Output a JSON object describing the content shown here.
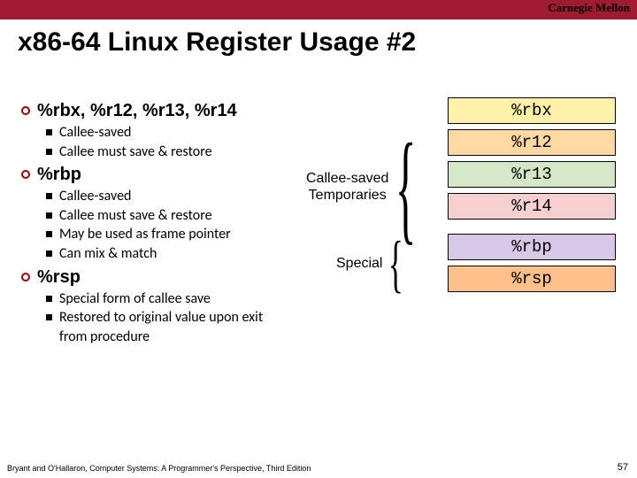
{
  "brand": "Carnegie Mellon",
  "title": "x86-64 Linux Register Usage #2",
  "sections": [
    {
      "heading": "%rbx, %r12, %r13, %r14",
      "items": [
        "Callee-saved",
        "Callee must save & restore"
      ]
    },
    {
      "heading": "%rbp",
      "items": [
        "Callee-saved",
        "Callee must save & restore",
        "May be used as frame pointer",
        "Can mix & match"
      ]
    },
    {
      "heading": "%rsp",
      "items": [
        "Special form of callee save",
        "Restored to original value upon exit from procedure"
      ]
    }
  ],
  "group_labels": {
    "callee_saved_line1": "Callee-saved",
    "callee_saved_line2": "Temporaries",
    "special": "Special"
  },
  "registers": [
    {
      "name": "%rbx",
      "color": "c-yellow"
    },
    {
      "name": "%r12",
      "color": "c-peach"
    },
    {
      "name": "%r13",
      "color": "c-green"
    },
    {
      "name": "%r14",
      "color": "c-pink"
    },
    {
      "name": "%rbp",
      "color": "c-purple"
    },
    {
      "name": "%rsp",
      "color": "c-orange"
    }
  ],
  "footer": "Bryant and O'Hallaron, Computer Systems: A Programmer's Perspective, Third Edition",
  "page": "57"
}
